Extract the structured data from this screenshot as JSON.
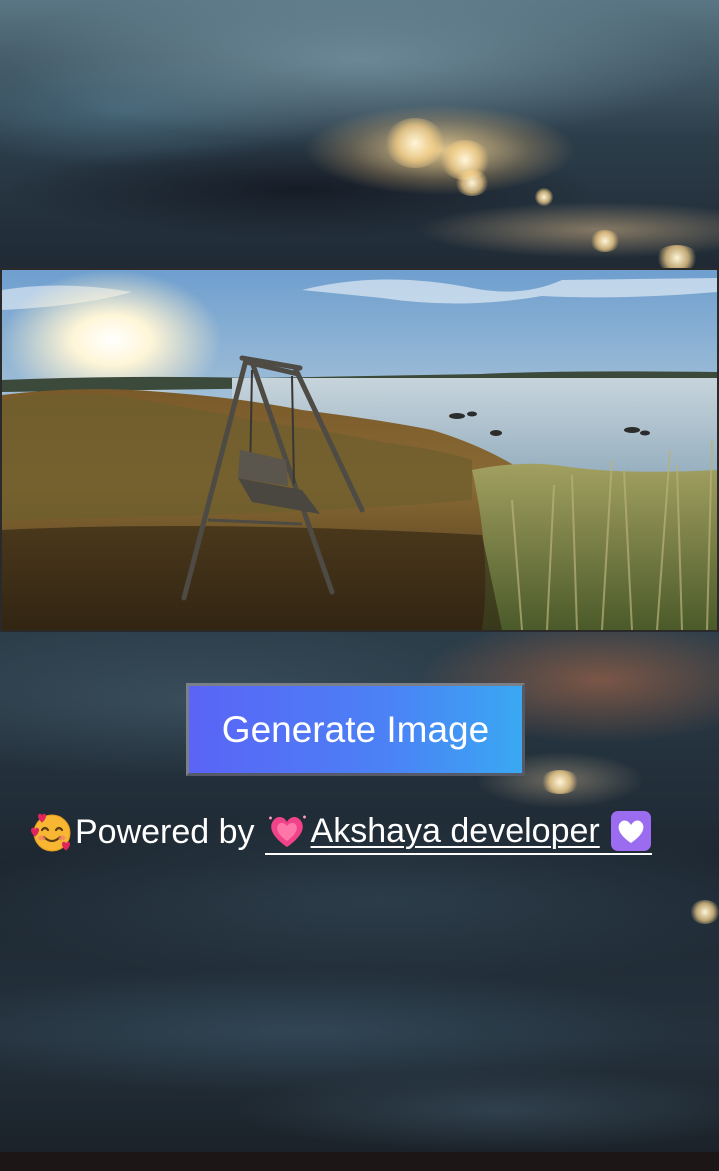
{
  "hero_image": {
    "icon": "lakeside-swing-photo"
  },
  "actions": {
    "generate_label": "Generate Image"
  },
  "footer": {
    "prefix_emoji": "smiling-face-with-hearts-icon",
    "powered_text": "Powered by",
    "link_text": "Akshaya developer",
    "link_leading_emoji": "growing-heart-icon",
    "link_trailing_emoji": "white-heart-icon"
  },
  "colors": {
    "button_start": "#5a64f6",
    "button_end": "#3aa8f2",
    "text": "#ffffff"
  }
}
